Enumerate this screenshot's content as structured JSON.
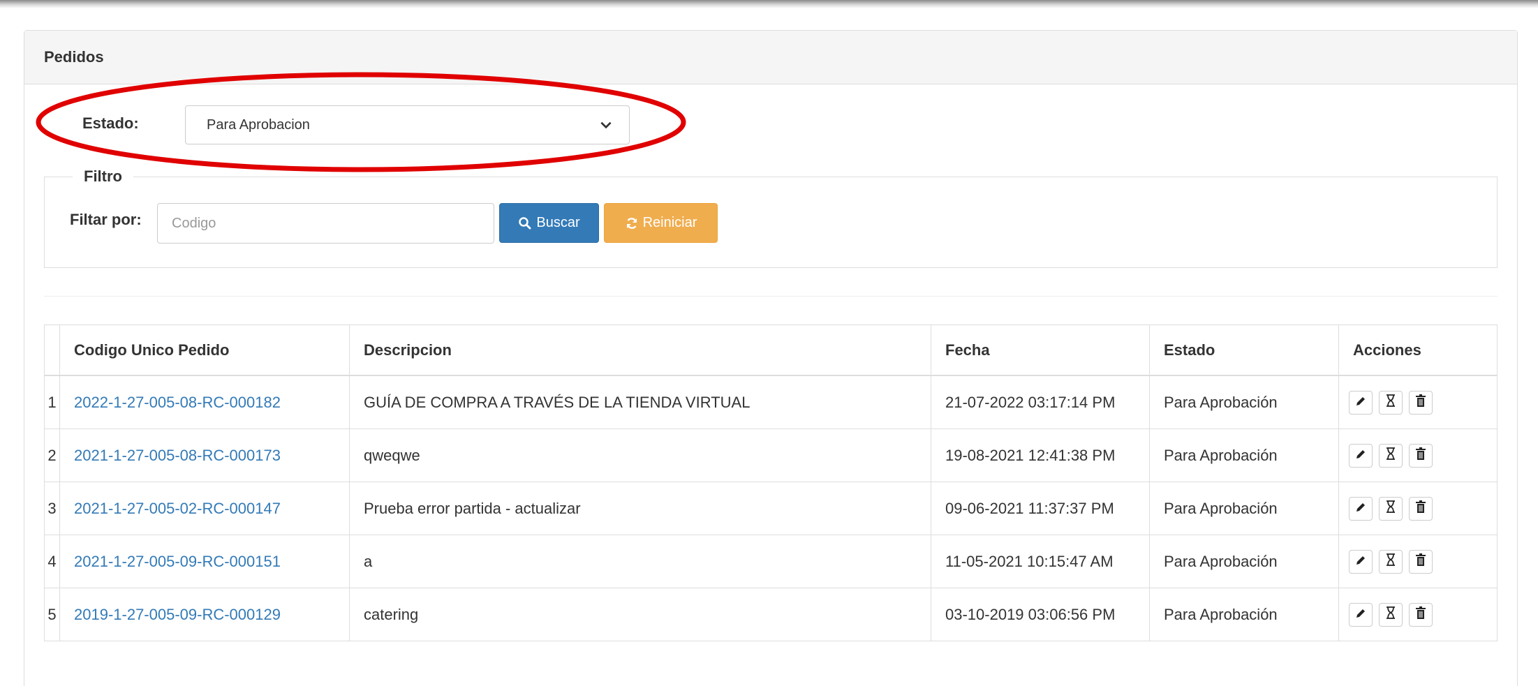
{
  "panel": {
    "title": "Pedidos"
  },
  "estado": {
    "label": "Estado:",
    "selected": "Para Aprobacion"
  },
  "filter": {
    "legend": "Filtro",
    "label": "Filtar por:",
    "placeholder": "Codigo",
    "value": "",
    "search_label": "Buscar",
    "reset_label": "Reiniciar"
  },
  "table": {
    "headers": {
      "num": "",
      "code": "Codigo Unico Pedido",
      "desc": "Descripcion",
      "date": "Fecha",
      "state": "Estado",
      "actions": "Acciones"
    },
    "rows": [
      {
        "num": "1",
        "code": "2022-1-27-005-08-RC-000182",
        "desc": "GUÍA DE COMPRA A TRAVÉS DE LA TIENDA VIRTUAL",
        "date": "21-07-2022 03:17:14 PM",
        "state": "Para Aprobación"
      },
      {
        "num": "2",
        "code": "2021-1-27-005-08-RC-000173",
        "desc": "qweqwe",
        "date": "19-08-2021 12:41:38 PM",
        "state": "Para Aprobación"
      },
      {
        "num": "3",
        "code": "2021-1-27-005-02-RC-000147",
        "desc": "Prueba error partida - actualizar",
        "date": "09-06-2021 11:37:37 PM",
        "state": "Para Aprobación"
      },
      {
        "num": "4",
        "code": "2021-1-27-005-09-RC-000151",
        "desc": "a",
        "date": "11-05-2021 10:15:47 AM",
        "state": "Para Aprobación"
      },
      {
        "num": "5",
        "code": "2019-1-27-005-09-RC-000129",
        "desc": "catering",
        "date": "03-10-2019 03:06:56 PM",
        "state": "Para Aprobación"
      }
    ]
  },
  "icons": {
    "search": "search-icon",
    "reset": "refresh-icon",
    "edit": "pencil-icon",
    "history": "hourglass-icon",
    "delete": "trash-icon",
    "select": "chevron-down-icon"
  },
  "colors": {
    "primary": "#337ab7",
    "warning": "#f0ad4e",
    "highlight": "#e00000"
  }
}
